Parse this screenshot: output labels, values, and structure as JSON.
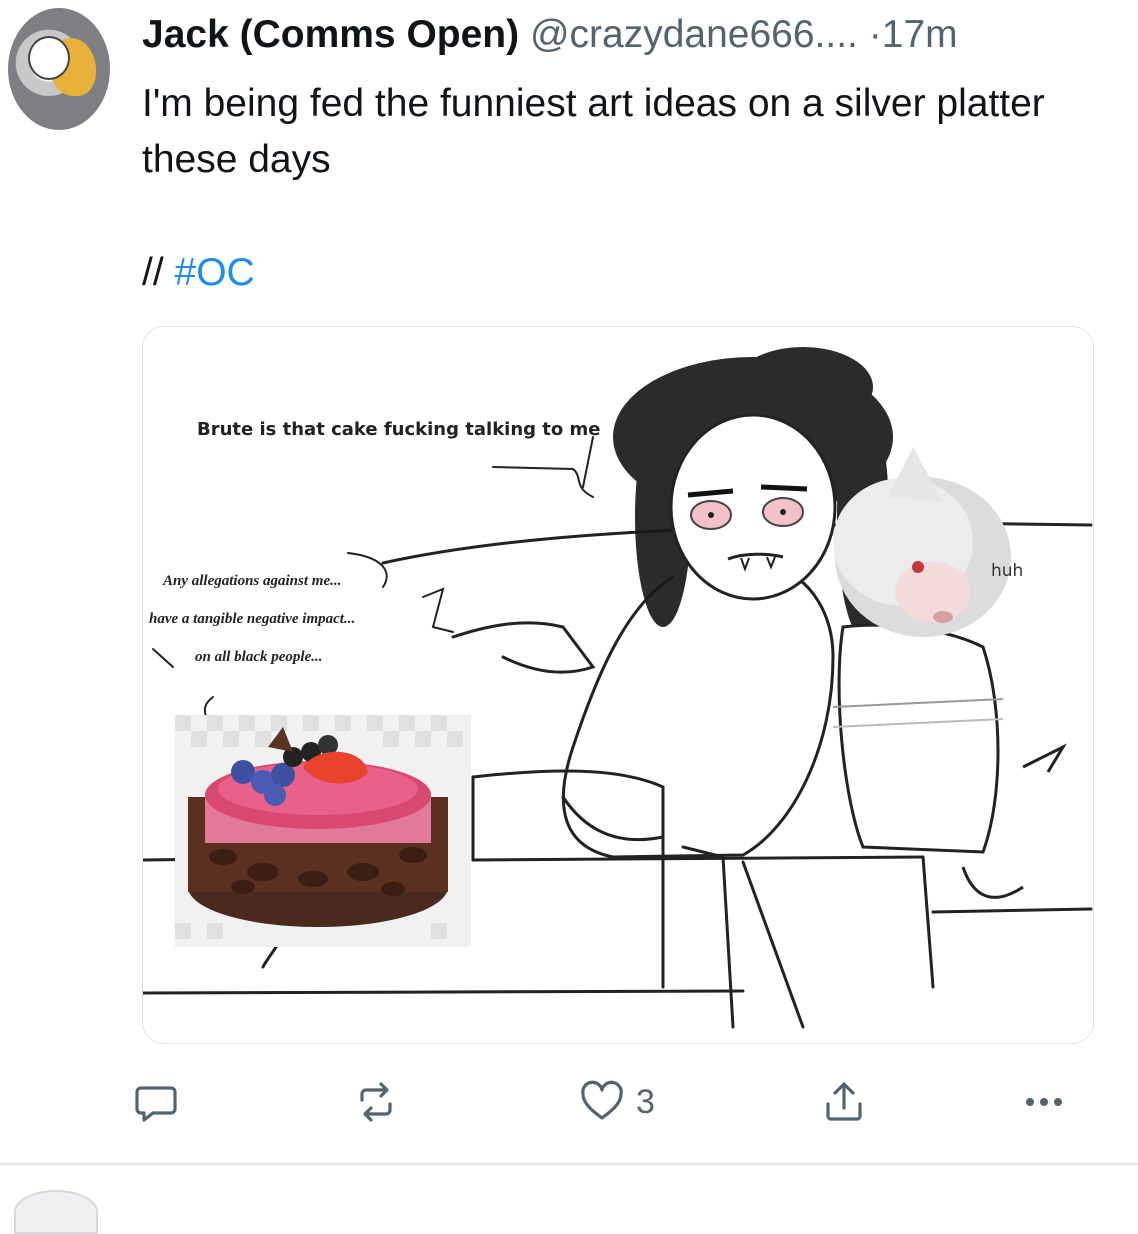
{
  "post": {
    "author_name": "Jack (Comms Open)",
    "author_handle": "@crazydane666....",
    "separator": "·",
    "time_ago": "17m",
    "text": "I'm being fed the funniest art ideas on a silver platter these days",
    "tag_prefix": "//",
    "hashtag": "#OC",
    "image": {
      "speech_main": "Brute is that cake fucking talking to me",
      "speech_cake_1": "Any allegations against me...",
      "speech_cake_2": "have a tangible negative impact...",
      "speech_cake_3": "on all black people...",
      "speech_dog": "huh"
    },
    "actions": {
      "reply_icon": "reply-icon",
      "repost_icon": "repost-icon",
      "like_icon": "heart-icon",
      "like_count": "3",
      "share_icon": "share-icon",
      "more_icon": "more-dots-icon"
    }
  },
  "colors": {
    "text_primary": "#0f1419",
    "text_secondary": "#536471",
    "link": "#1d8cf0",
    "border": "#dfe3e6"
  }
}
